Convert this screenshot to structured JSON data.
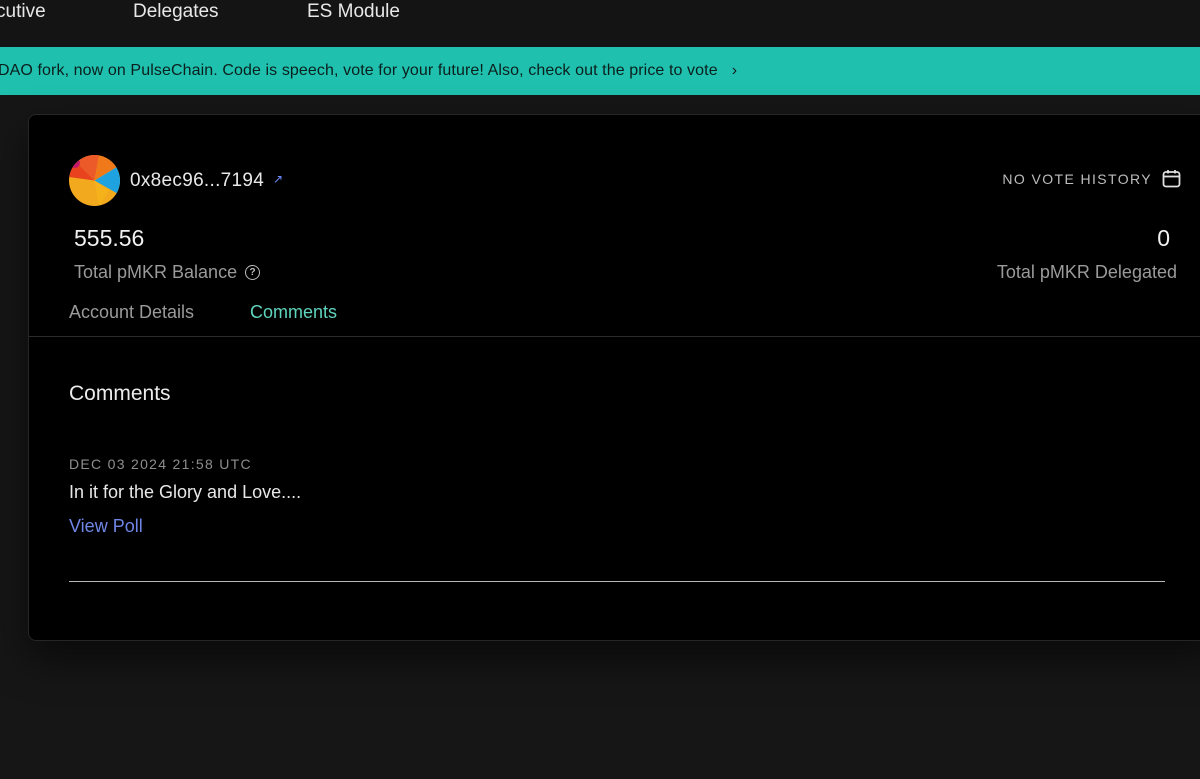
{
  "nav": {
    "items": [
      {
        "label": "cutive"
      },
      {
        "label": "Delegates"
      },
      {
        "label": "ES Module"
      }
    ]
  },
  "banner": {
    "text": "DAO fork, now on PulseChain. Code is speech, vote for your future! Also, check out the price to vote",
    "chevron": "›",
    "color": "#1fc0ae"
  },
  "profile": {
    "address": "0x8ec96...7194",
    "external_icon": "external-link-icon",
    "vote_history_label": "NO VOTE HISTORY",
    "vote_history_icon": "calendar-icon",
    "balance_value": "555.56",
    "balance_label": "Total pMKR Balance",
    "delegated_value": "0",
    "delegated_label": "Total pMKR Delegated"
  },
  "tabs": [
    {
      "label": "Account Details",
      "active": false
    },
    {
      "label": "Comments",
      "active": true
    }
  ],
  "comments_section": {
    "title": "Comments",
    "items": [
      {
        "date": "DEC 03 2024 21:58 UTC",
        "text": "In it for the Glory and Love....",
        "link_label": "View Poll"
      }
    ]
  },
  "colors": {
    "accent_tab": "#5fd4bd",
    "link": "#6f86e8",
    "card_bg": "#000000",
    "page_bg": "#161616"
  }
}
